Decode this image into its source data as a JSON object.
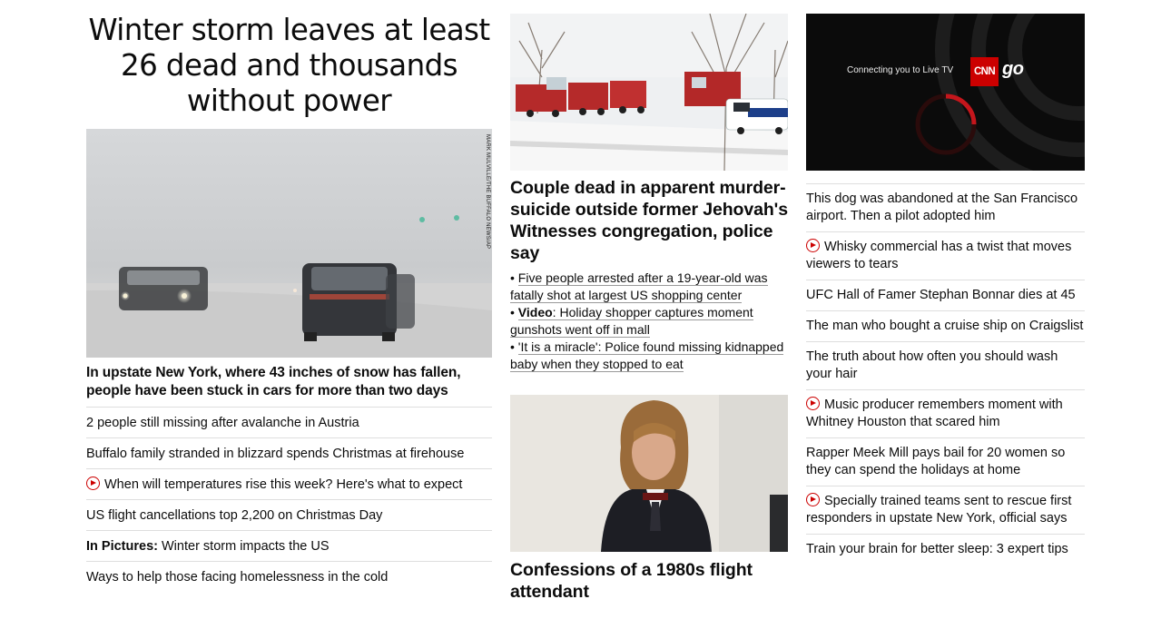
{
  "hero": {
    "title": "Winter storm leaves at least 26 dead and thousands without power",
    "photo_credit": "MARK MULVILLE/THE BUFFALO NEWS/AP",
    "lead": "In upstate New York, where 43 inches of snow has fallen, people have been stuck in cars for more than two days",
    "links": [
      {
        "text": "2 people still missing after avalanche in Austria",
        "video": false,
        "prefix": ""
      },
      {
        "text": "Buffalo family stranded in blizzard spends Christmas at firehouse",
        "video": false,
        "prefix": ""
      },
      {
        "text": "When will temperatures rise this week? Here's what to expect",
        "video": true,
        "prefix": ""
      },
      {
        "text": "US flight cancellations top 2,200 on Christmas Day",
        "video": false,
        "prefix": ""
      },
      {
        "text": "Winter storm impacts the US",
        "video": false,
        "prefix": "In Pictures:"
      },
      {
        "text": "Ways to help those facing homelessness in the cold",
        "video": false,
        "prefix": ""
      }
    ]
  },
  "middle": {
    "story1": {
      "title": "Couple dead in apparent murder-suicide outside former Jehovah's Witnesses congregation, police say",
      "bullets": [
        {
          "prefix": "",
          "text": "Five people arrested after a 19-year-old was fatally shot at largest US shopping center"
        },
        {
          "prefix": "Video",
          "text": "Holiday shopper captures moment gunshots went off in mall"
        },
        {
          "prefix": "",
          "text": "'It is a miracle': Police found missing kidnapped baby when they stopped to eat"
        }
      ]
    },
    "story2": {
      "title": "Confessions of a 1980s flight attendant"
    }
  },
  "right": {
    "live_tv": {
      "connecting_text": "Connecting you to Live TV",
      "logo_text": "CNN",
      "go_text": "go"
    },
    "links": [
      {
        "text": "This dog was abandoned at the San Francisco airport. Then a pilot adopted him",
        "video": false
      },
      {
        "text": "Whisky commercial has a twist that moves viewers to tears",
        "video": true
      },
      {
        "text": "UFC Hall of Famer Stephan Bonnar dies at 45",
        "video": false
      },
      {
        "text": "The man who bought a cruise ship on Craigslist",
        "video": false
      },
      {
        "text": "The truth about how often you should wash your hair",
        "video": false
      },
      {
        "text": "Music producer remembers moment with Whitney Houston that scared him",
        "video": true
      },
      {
        "text": "Rapper Meek Mill pays bail for 20 women so they can spend the holidays at home",
        "video": false
      },
      {
        "text": "Specially trained teams sent to rescue first responders in upstate New York, official says",
        "video": true
      },
      {
        "text": "Train your brain for better sleep: 3 expert tips",
        "video": false
      }
    ]
  },
  "colors": {
    "accent": "#cc0000",
    "text": "#0c0c0c",
    "divider": "#dedede"
  },
  "icons": {
    "video_link": "play-circle-icon"
  }
}
